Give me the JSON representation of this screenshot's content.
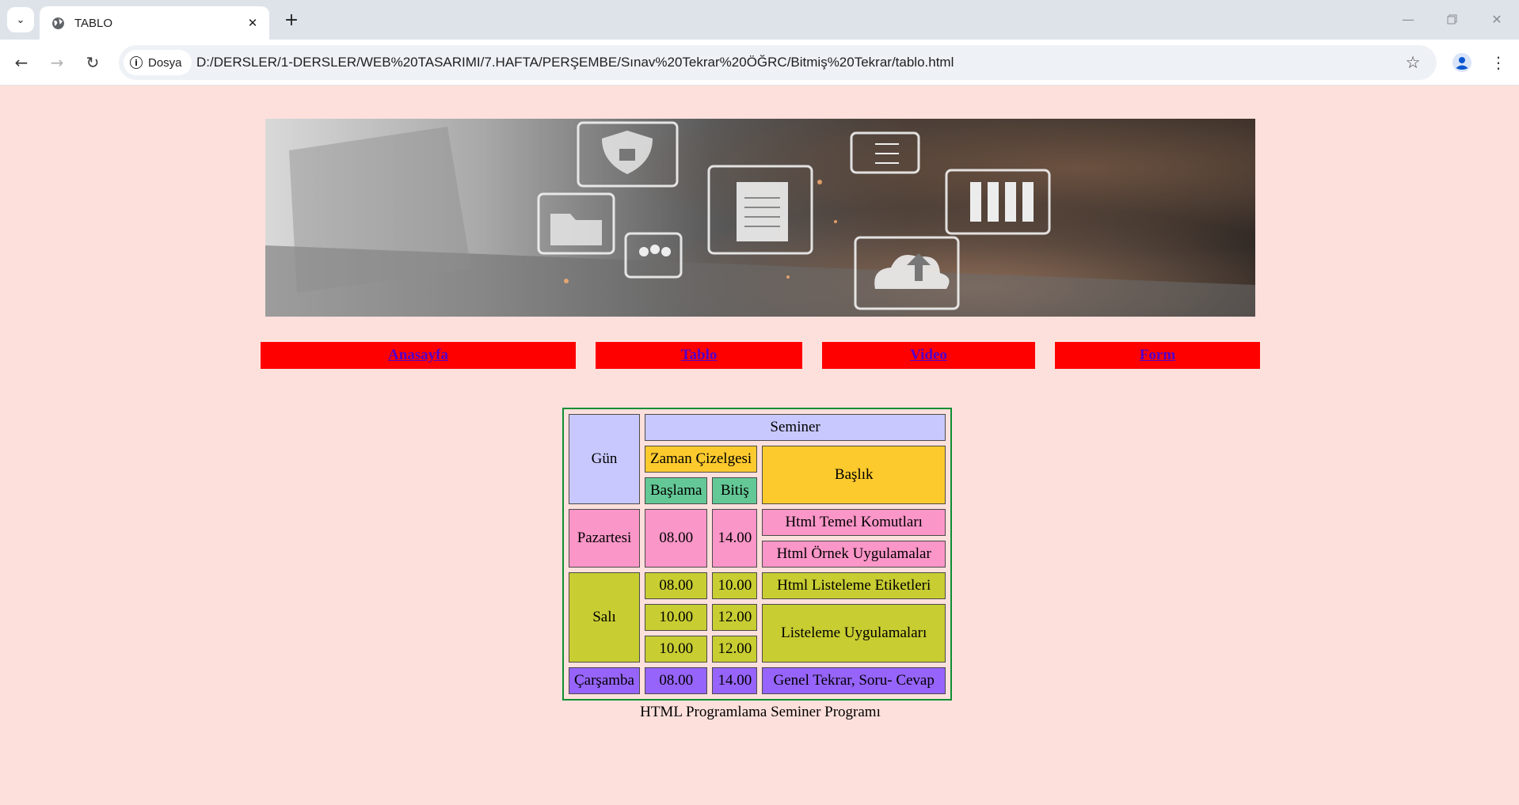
{
  "browser": {
    "tab_title": "TABLO",
    "site_chip": "Dosya",
    "url": "D:/DERSLER/1-DERSLER/WEB%20TASARIMI/7.HAFTA/PERŞEMBE/Sınav%20Tekrar%20ÖĞRC/Bitmiş%20Tekrar/tablo.html",
    "new_tab_label": "+",
    "close_tab_label": "✕"
  },
  "nav": {
    "items": [
      {
        "label": "Anasayfa"
      },
      {
        "label": "Tablo"
      },
      {
        "label": "Video"
      },
      {
        "label": "Form"
      }
    ]
  },
  "table": {
    "header": {
      "gun": "Gün",
      "seminer": "Seminer",
      "zaman": "Zaman Çizelgesi",
      "baslik": "Başlık",
      "baslama": "Başlama",
      "bitis": "Bitiş"
    },
    "pazartesi": {
      "day": "Pazartesi",
      "start": "08.00",
      "end": "14.00",
      "topics": [
        "Html Temel Komutları",
        "Html Örnek Uygulamalar"
      ]
    },
    "sali": {
      "day": "Salı",
      "rows": [
        {
          "start": "08.00",
          "end": "10.00"
        },
        {
          "start": "10.00",
          "end": "12.00"
        },
        {
          "start": "10.00",
          "end": "12.00"
        }
      ],
      "topics": [
        "Html Listeleme Etiketleri",
        "Listeleme Uygulamaları"
      ]
    },
    "carsamba": {
      "day": "Çarşamba",
      "start": "08.00",
      "end": "14.00",
      "topic": "Genel Tekrar, Soru- Cevap"
    }
  },
  "caption": "HTML Programlama Seminer Programı",
  "colors": {
    "page_bg": "#fde0dc",
    "nav_bg": "#ff0000",
    "link": "#5500c8",
    "header_blue": "#c8c8ff",
    "header_orange": "#fdca2e",
    "header_green": "#64c896",
    "monday_pink": "#fb96c8",
    "tuesday_olive": "#c8cd32",
    "wednesday_purple": "#9664fa",
    "table_border": "#0d8f34"
  }
}
